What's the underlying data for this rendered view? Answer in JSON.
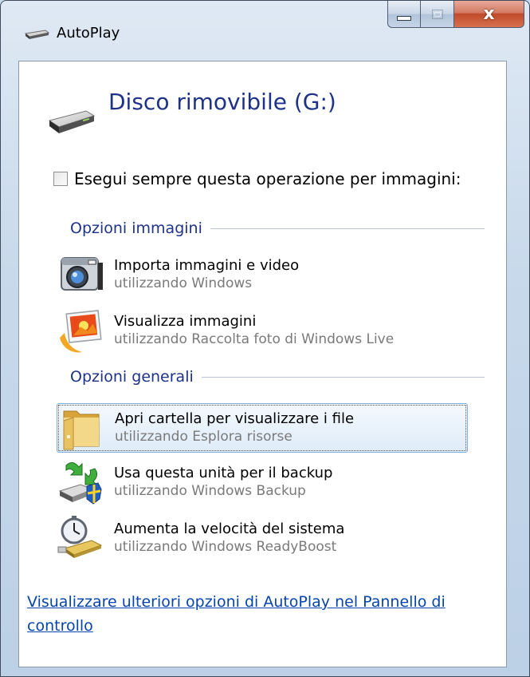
{
  "window": {
    "title": "AutoPlay",
    "close_glyph": "x"
  },
  "device": {
    "name": "Disco rimovibile (G:)",
    "icon": "removable-drive-icon"
  },
  "always": {
    "label": "Esegui sempre questa operazione per immagini:",
    "checked": false
  },
  "sections": [
    {
      "label": "Opzioni immagini",
      "items": [
        {
          "main": "Importa immagini e video",
          "sub": "utilizzando Windows",
          "icon": "camera-icon"
        },
        {
          "main": "Visualizza immagini",
          "sub": "utilizzando Raccolta foto di Windows Live",
          "icon": "photo-gallery-icon"
        }
      ]
    },
    {
      "label": "Opzioni generali",
      "items": [
        {
          "main": "Apri cartella per visualizzare i file",
          "sub": "utilizzando Esplora risorse",
          "icon": "folder-icon",
          "selected": true
        },
        {
          "main": "Usa questa unità per il backup",
          "sub": "utilizzando Windows Backup",
          "icon": "backup-icon"
        },
        {
          "main": "Aumenta la velocità del sistema",
          "sub": "utilizzando Windows ReadyBoost",
          "icon": "readyboost-icon"
        }
      ]
    }
  ],
  "more_link": "Visualizzare ulteriori opzioni di AutoPlay nel Pannello di controllo",
  "colors": {
    "heading": "#1e3287",
    "link": "#0645ad",
    "subtext": "#7a7a7a",
    "selection_border": "#84acdd"
  }
}
